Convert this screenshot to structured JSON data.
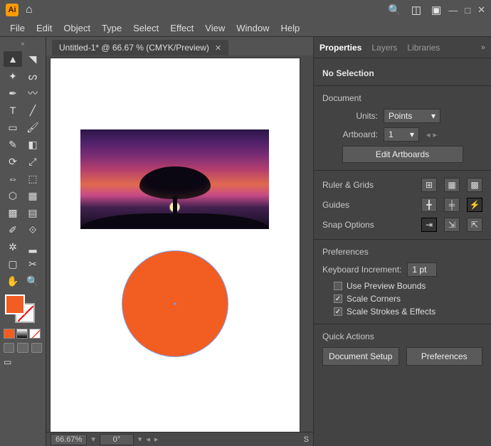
{
  "app": {
    "abbrev": "Ai"
  },
  "menu": [
    "File",
    "Edit",
    "Object",
    "Type",
    "Select",
    "Effect",
    "View",
    "Window",
    "Help"
  ],
  "doc_tab": {
    "title": "Untitled-1* @ 66.67 % (CMYK/Preview)"
  },
  "status": {
    "zoom": "66.67%",
    "rotate": "0°",
    "right": "S"
  },
  "panel": {
    "tabs": [
      "Properties",
      "Layers",
      "Libraries"
    ],
    "active_tab": 0,
    "selection": "No Selection",
    "section_document": "Document",
    "units_label": "Units:",
    "units_value": "Points",
    "artboard_label": "Artboard:",
    "artboard_value": "1",
    "edit_artboards": "Edit Artboards",
    "ruler_label": "Ruler & Grids",
    "guides_label": "Guides",
    "snap_label": "Snap Options",
    "prefs_section": "Preferences",
    "key_incr_label": "Keyboard Increment:",
    "key_incr_value": "1 pt",
    "chk_preview": "Use Preview Bounds",
    "chk_corners": "Scale Corners",
    "chk_strokes": "Scale Strokes & Effects",
    "quick_actions": "Quick Actions",
    "qa_docsetup": "Document Setup",
    "qa_prefs": "Preferences"
  },
  "colors": {
    "fill": "#f25d22",
    "accent_circle": "#f25d22"
  },
  "tool_names": [
    "selection-tool",
    "direct-selection-tool",
    "magic-wand-tool",
    "lasso-tool",
    "pen-tool",
    "curvature-tool",
    "type-tool",
    "line-segment-tool",
    "rectangle-tool",
    "paintbrush-tool",
    "shaper-tool",
    "eraser-tool",
    "rotate-tool",
    "scale-tool",
    "width-tool",
    "free-transform-tool",
    "shape-builder-tool",
    "perspective-grid-tool",
    "mesh-tool",
    "gradient-tool",
    "eyedropper-tool",
    "blend-tool",
    "symbol-sprayer-tool",
    "column-graph-tool",
    "artboard-tool",
    "slice-tool",
    "hand-tool",
    "zoom-tool"
  ],
  "tool_glyphs": [
    "▲",
    "◥",
    "✦",
    "ᔕ",
    "✒",
    "〰",
    "T",
    "╱",
    "▭",
    "🖌",
    "✎",
    "◧",
    "⟳",
    "⤢",
    "⇔",
    "⬚",
    "⬡",
    "▦",
    "▩",
    "▤",
    "✐",
    "⟐",
    "✲",
    "▂",
    "▢",
    "✂",
    "✋",
    "🔍"
  ]
}
